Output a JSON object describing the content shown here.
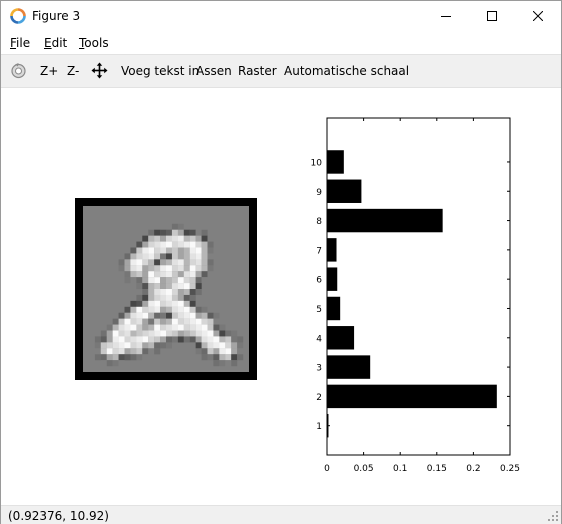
{
  "window": {
    "title": "Figure 3"
  },
  "menu": [
    {
      "label": "File",
      "underline": "F",
      "rest": "ile"
    },
    {
      "label": "Edit",
      "underline": "E",
      "rest": "dit"
    },
    {
      "label": "Tools",
      "underline": "T",
      "rest": "ools"
    }
  ],
  "toolbar": {
    "zoom_in": "Z+",
    "zoom_out": "Z-",
    "insert_text": "Voeg tekst in",
    "axes": "Assen",
    "grid": "Raster",
    "autoscale": "Automatische schaal"
  },
  "status": {
    "coordinates": "(0.92376, 10.92)"
  },
  "colors": {
    "bar": "#000000",
    "image_background": "#808080",
    "toolbar": "#f0f0f0"
  },
  "icons": [
    "octave-logo-icon",
    "minimize-icon",
    "maximize-icon",
    "close-icon",
    "rotate-icon",
    "pan-icon",
    "resize-grip-icon"
  ],
  "chart_data": {
    "type": "bar",
    "orientation": "horizontal",
    "categories": [
      "1",
      "2",
      "3",
      "4",
      "5",
      "6",
      "7",
      "8",
      "9",
      "10"
    ],
    "values": [
      0.002,
      0.232,
      0.059,
      0.037,
      0.018,
      0.014,
      0.013,
      0.158,
      0.047,
      0.023
    ],
    "xlim": [
      0,
      0.25
    ],
    "ylim": [
      0,
      11.5
    ],
    "xticks": [
      "0",
      "0.05",
      "0.1",
      "0.15",
      "0.2",
      "0.25"
    ],
    "yticks": [
      "1",
      "2",
      "3",
      "4",
      "5",
      "6",
      "7",
      "8",
      "9",
      "10"
    ],
    "grid": false
  }
}
